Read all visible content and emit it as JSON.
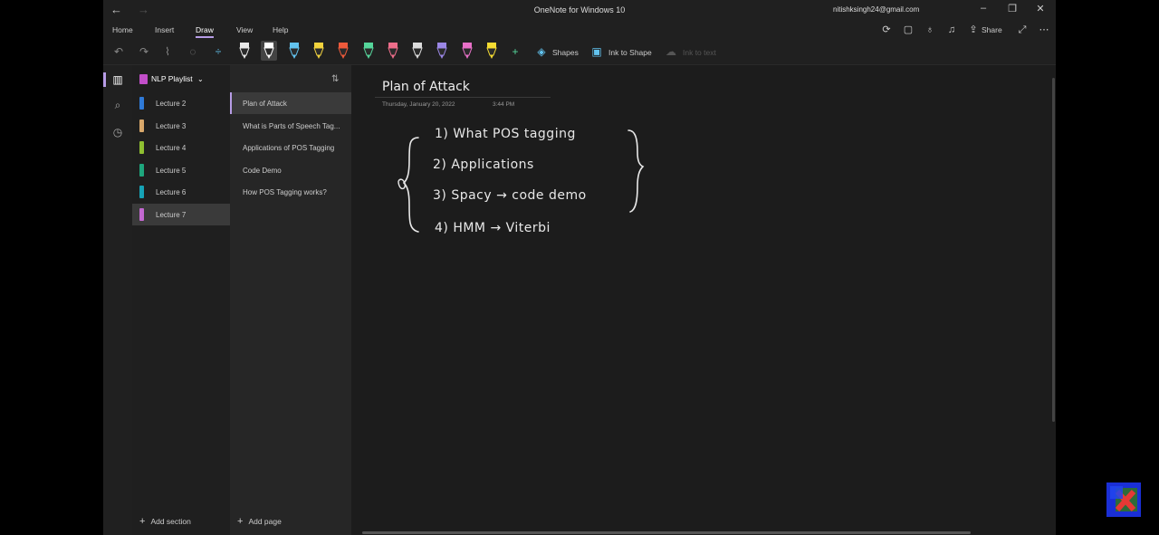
{
  "window": {
    "title": "OneNote for Windows 10",
    "user_email": "nitishksingh24@gmail.com"
  },
  "menu": {
    "tabs": [
      {
        "label": "Home"
      },
      {
        "label": "Insert"
      },
      {
        "label": "Draw",
        "active": true
      },
      {
        "label": "View"
      },
      {
        "label": "Help"
      }
    ],
    "share_label": "Share"
  },
  "draw_toolbar": {
    "shapes_label": "Shapes",
    "ink_to_shape_label": "Ink to Shape",
    "ink_to_text_label": "Ink to text",
    "pens": [
      {
        "color": "#e9e9e9"
      },
      {
        "color": "#ffffff"
      },
      {
        "color": "#62c3ef"
      },
      {
        "color": "#f3d33d"
      },
      {
        "color": "#ee5a3b"
      },
      {
        "color": "#55d69b"
      },
      {
        "color": "#ee6d8a"
      },
      {
        "color": "#dcdcdc"
      },
      {
        "color": "#9b87e6"
      },
      {
        "color": "#e870c8"
      },
      {
        "color": "#f6dc32"
      }
    ]
  },
  "notebook": {
    "name": "NLP Playlist",
    "sections": [
      {
        "label": "Lecture 2",
        "color": "#2f7ad8"
      },
      {
        "label": "Lecture 3",
        "color": "#d9a86b"
      },
      {
        "label": "Lecture 4",
        "color": "#8fbf31"
      },
      {
        "label": "Lecture 5",
        "color": "#1ea67d"
      },
      {
        "label": "Lecture 6",
        "color": "#16a3b6"
      },
      {
        "label": "Lecture 7",
        "color": "#c368d1",
        "selected": true
      }
    ],
    "add_section_label": "Add section"
  },
  "pages": {
    "items": [
      {
        "label": "Plan of Attack",
        "selected": true
      },
      {
        "label": "What is Parts of Speech Tag..."
      },
      {
        "label": "Applications of POS Tagging"
      },
      {
        "label": "Code Demo"
      },
      {
        "label": "How POS Tagging works?"
      }
    ],
    "add_page_label": "Add page"
  },
  "page": {
    "title": "Plan of Attack",
    "date": "Thursday, January 20, 2022",
    "time": "3:44 PM",
    "ink_lines": [
      "1)  What POS tagging",
      "2)  Applications",
      "3)  Spacy → code demo",
      "4)  HMM → Viterbi"
    ]
  }
}
